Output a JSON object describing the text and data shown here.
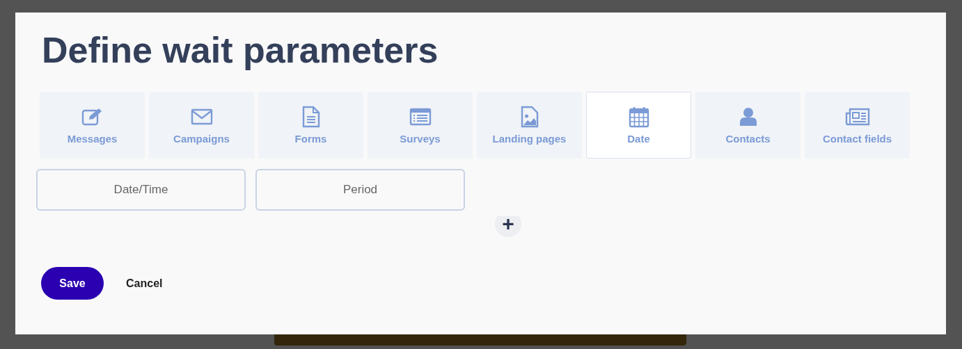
{
  "dialog": {
    "title": "Define wait parameters"
  },
  "tabs": [
    {
      "label": "Messages",
      "selected": false
    },
    {
      "label": "Campaigns",
      "selected": false
    },
    {
      "label": "Forms",
      "selected": false
    },
    {
      "label": "Surveys",
      "selected": false
    },
    {
      "label": "Landing pages",
      "selected": false
    },
    {
      "label": "Date",
      "selected": true
    },
    {
      "label": "Contacts",
      "selected": false
    },
    {
      "label": "Contact fields",
      "selected": false
    }
  ],
  "options": [
    {
      "label": "Date/Time"
    },
    {
      "label": "Period"
    }
  ],
  "add_button": {
    "label": "+"
  },
  "buttons": [
    {
      "label": "Save",
      "kind": "primary"
    },
    {
      "label": "Cancel",
      "kind": "plain"
    }
  ]
}
